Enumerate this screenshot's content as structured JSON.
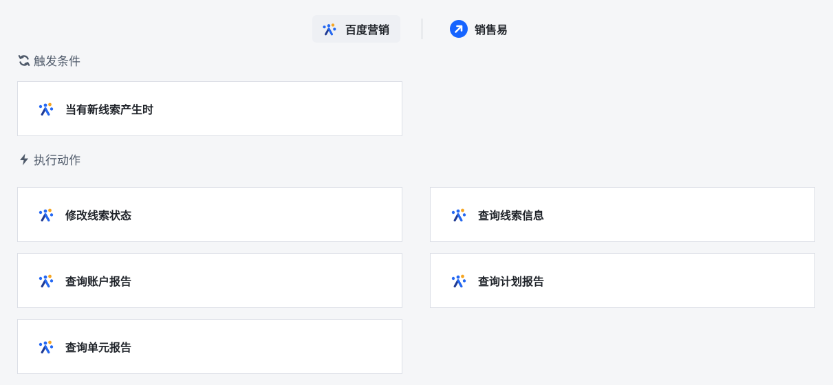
{
  "tabs": [
    {
      "label": "百度营销",
      "icon": "baidu-marketing-icon",
      "selected": true
    },
    {
      "label": "销售易",
      "icon": "xiaoshouyi-arrow-icon",
      "selected": false
    }
  ],
  "sections": {
    "trigger": {
      "title": "触发条件",
      "icon": "refresh-icon"
    },
    "action": {
      "title": "执行动作",
      "icon": "lightning-icon"
    }
  },
  "triggers": [
    {
      "label": "当有新线索产生时",
      "icon": "baidu-marketing-icon"
    }
  ],
  "actions": [
    {
      "label": "修改线索状态",
      "icon": "baidu-marketing-icon"
    },
    {
      "label": "查询线索信息",
      "icon": "baidu-marketing-icon"
    },
    {
      "label": "查询账户报告",
      "icon": "baidu-marketing-icon"
    },
    {
      "label": "查询计划报告",
      "icon": "baidu-marketing-icon"
    },
    {
      "label": "查询单元报告",
      "icon": "baidu-marketing-icon"
    }
  ],
  "colors": {
    "background": "#f5f6f8",
    "xiaoshouyi_blue": "#1664ff",
    "logo_blue": "#2468f2",
    "logo_orange": "#f5a623",
    "logo_dark": "#1f3a93"
  }
}
